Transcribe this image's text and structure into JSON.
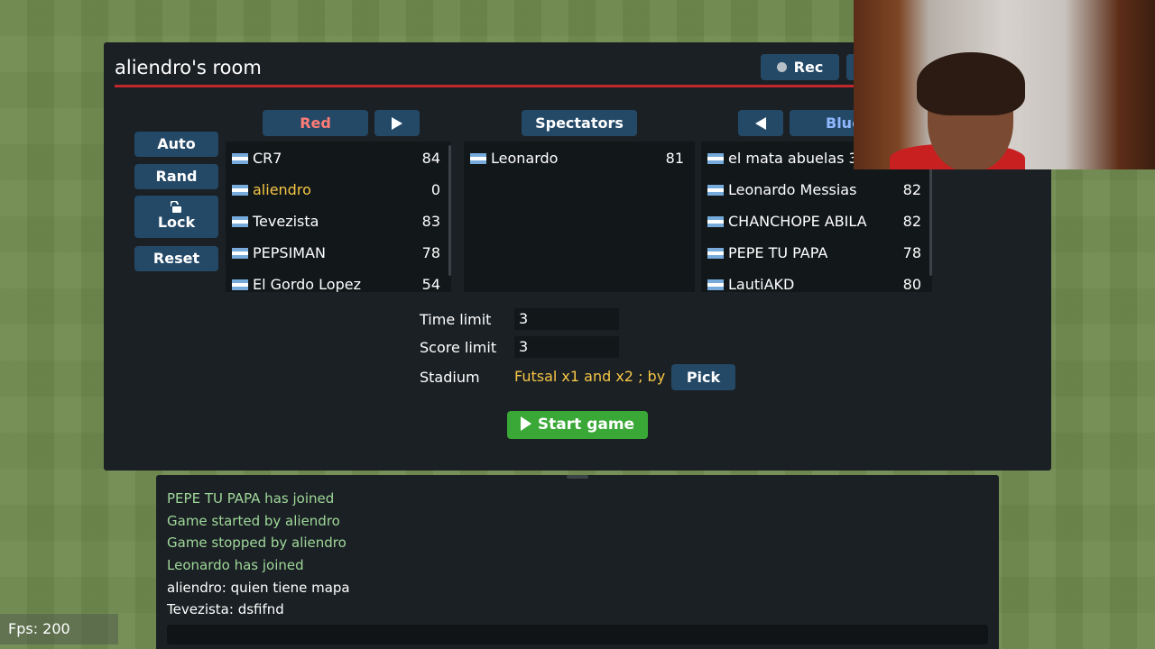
{
  "room": {
    "title": "aliendro's room",
    "rec_label": "Rec"
  },
  "side_buttons": {
    "auto": "Auto",
    "rand": "Rand",
    "lock": "Lock",
    "reset": "Reset"
  },
  "teams": {
    "red": {
      "label": "Red",
      "players": [
        {
          "name": "CR7",
          "score": "84"
        },
        {
          "name": "aliendro",
          "score": "0"
        },
        {
          "name": "Tevezista",
          "score": "83"
        },
        {
          "name": "PEPSIMAN",
          "score": "78"
        },
        {
          "name": "El Gordo Lopez",
          "score": "54"
        }
      ]
    },
    "spectators": {
      "label": "Spectators",
      "players": [
        {
          "name": "Leonardo",
          "score": "81"
        }
      ]
    },
    "blue": {
      "label": "Blue",
      "players": [
        {
          "name": "el mata abuelas 3",
          "score": ""
        },
        {
          "name": "Leonardo Messias",
          "score": "82"
        },
        {
          "name": "CHANCHOPE ABILA",
          "score": "82"
        },
        {
          "name": "PEPE TU PAPA",
          "score": "78"
        },
        {
          "name": "LautiAKD",
          "score": "80"
        }
      ]
    }
  },
  "settings": {
    "time_limit_label": "Time limit",
    "time_limit_value": "3",
    "score_limit_label": "Score limit",
    "score_limit_value": "3",
    "stadium_label": "Stadium",
    "stadium_value": "Futsal x1 and x2 ; by ...",
    "pick_label": "Pick",
    "start_label": "Start game"
  },
  "chat": {
    "lines": [
      {
        "text": "PEPE TU PAPA has joined",
        "type": "system"
      },
      {
        "text": "Game started by aliendro",
        "type": "system"
      },
      {
        "text": "Game stopped by aliendro",
        "type": "system"
      },
      {
        "text": "Leonardo has joined",
        "type": "system"
      },
      {
        "text": "aliendro: quien tiene mapa",
        "type": "message"
      },
      {
        "text": "Tevezista: dsfifnd",
        "type": "message"
      }
    ]
  },
  "fps": "Fps: 200",
  "colors": {
    "panel": "#1b2024",
    "button": "#244967",
    "red_team": "#ff7c76",
    "blue_team": "#90b8ff",
    "highlight": "#f6c646",
    "start": "#3aa837",
    "system_chat": "#9fd89a"
  }
}
